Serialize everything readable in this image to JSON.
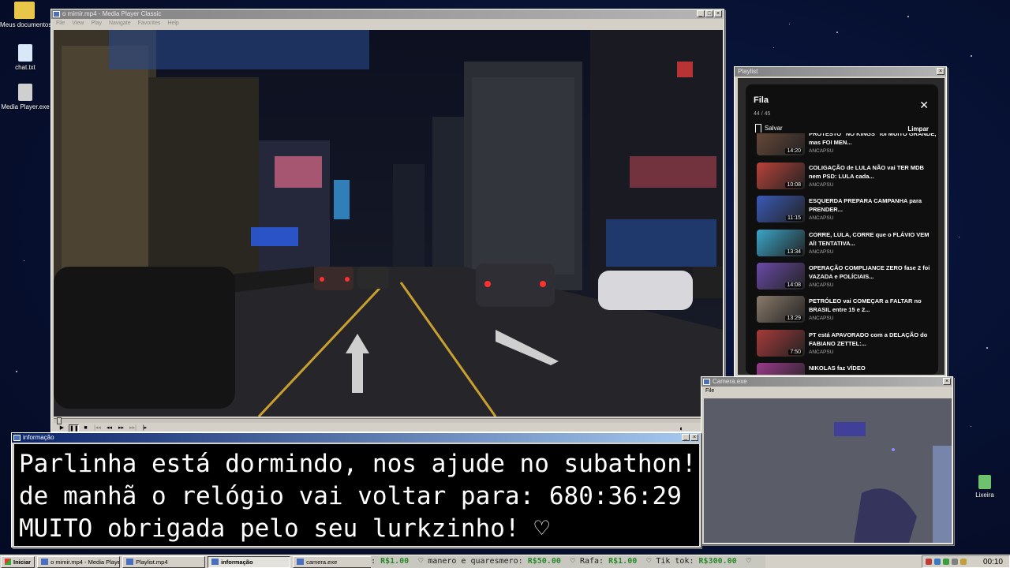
{
  "desktop": {
    "icons": [
      {
        "label": "Meus documentos",
        "icon": "folder-icon",
        "color": "#e8c64a"
      },
      {
        "label": "chat.txt",
        "icon": "notepad-icon",
        "color": "#d8e8f8"
      },
      {
        "label": "Media Player.exe",
        "icon": "media-player-icon",
        "color": "#cfcfcf"
      },
      {
        "label": "Lixeira",
        "icon": "recycle-bin-icon",
        "color": "#6ec26e"
      }
    ]
  },
  "media_player": {
    "title": "o mimir.mp4 - Media Player Classic",
    "menu": [
      "File",
      "View",
      "Play",
      "Navigate",
      "Favorites",
      "Help"
    ],
    "controls": [
      "play",
      "pause",
      "stop",
      "prev",
      "rew",
      "fwd",
      "next",
      "frame-step"
    ]
  },
  "playlist": {
    "window_title": "Playlist",
    "title": "Fila",
    "count": "44 / 45",
    "save_label": "Salvar",
    "clear_label": "Limpar",
    "items": [
      {
        "title": "PROTESTO \"NO KINGS\" foi MUITO GRANDE, mas FOI MEN...",
        "channel": "ANCAPSU",
        "duration": "14:20",
        "thumb": "#6b4a3a"
      },
      {
        "title": "COLIGAÇÃO de LULA NÃO vai TER MDB nem PSD: LULA cada...",
        "channel": "ANCAPSU",
        "duration": "10:08",
        "thumb": "#b9433a"
      },
      {
        "title": "ESQUERDA PREPARA CAMPANHA para PRENDER...",
        "channel": "ANCAPSU",
        "duration": "11:15",
        "thumb": "#3a5ab9"
      },
      {
        "title": "CORRE, LULA, CORRE que o FLÁVIO VEM AÍ! TENTATIVA...",
        "channel": "ANCAPSU",
        "duration": "13:34",
        "thumb": "#3aa6c9"
      },
      {
        "title": "OPERAÇÃO COMPLIANCE ZERO fase 2 foi VAZADA e POLÍCIAIS...",
        "channel": "ANCAPSU",
        "duration": "14:08",
        "thumb": "#6a4aa8"
      },
      {
        "title": "PETRÓLEO vai COMEÇAR a FALTAR no BRASIL entre 15 e 2...",
        "channel": "ANCAPSU",
        "duration": "13:29",
        "thumb": "#8a7a6a"
      },
      {
        "title": "PT está APAVORADO com a DELAÇÃO do FABIANO ZETTEL:...",
        "channel": "ANCAPSU",
        "duration": "7:50",
        "thumb": "#a83a3a"
      },
      {
        "title": "NIKOLAS faz VÍDEO",
        "channel": "",
        "duration": "",
        "thumb": "#9a3a8a"
      }
    ]
  },
  "camera": {
    "title": "Camera.exe",
    "menu": "File"
  },
  "info": {
    "title": "informação",
    "line1": "Parlinha está dormindo, nos ajude no subathon!",
    "line2": "de manhã o relógio vai voltar para:  680:36:29",
    "line3": "MUITO obrigada pelo seu lurkzinho! ♡"
  },
  "taskbar": {
    "start_label": "Iniciar",
    "tasks": [
      {
        "label": "o mimir.mp4 - Media Playe...",
        "active": false
      },
      {
        "label": "Playlist.mp4",
        "active": false
      },
      {
        "label": "informação",
        "active": true
      },
      {
        "label": "camera.exe",
        "active": false
      }
    ],
    "ticker": [
      {
        "name": ":",
        "amount": "R$1.00"
      },
      {
        "name": "♡  manero e quaresmero:",
        "amount": "R$50.00"
      },
      {
        "name": "♡  Rafa:",
        "amount": "R$1.00"
      },
      {
        "name": "♡  Tik tok:",
        "amount": "R$300.00"
      },
      {
        "name": "♡",
        "amount": ""
      }
    ],
    "clock": "00:10"
  }
}
